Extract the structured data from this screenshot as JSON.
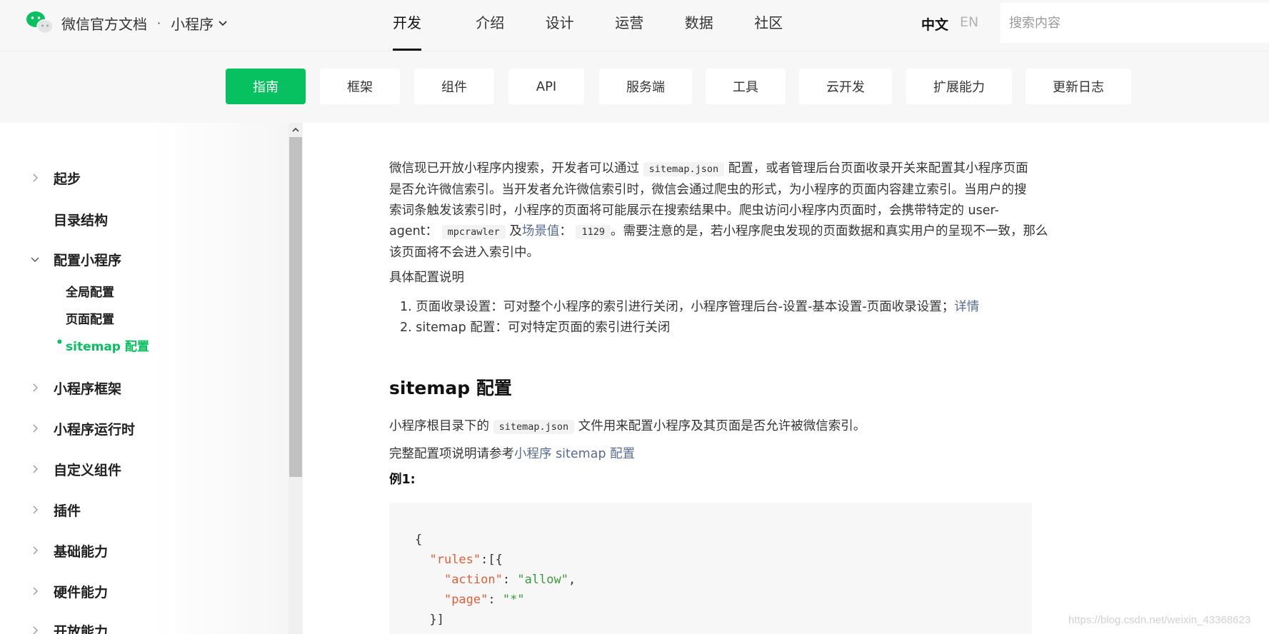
{
  "header": {
    "brand": "微信官方文档",
    "separator": "·",
    "product": "小程序",
    "tabs": [
      {
        "label": "开发",
        "active": true
      },
      {
        "label": "介绍"
      },
      {
        "label": "设计"
      },
      {
        "label": "运营"
      },
      {
        "label": "数据"
      },
      {
        "label": "社区"
      }
    ],
    "lang_zh": "中文",
    "lang_en": "EN",
    "search_placeholder": "搜索内容"
  },
  "subnav": {
    "items": [
      "指南",
      "框架",
      "组件",
      "API",
      "服务端",
      "工具",
      "云开发",
      "扩展能力",
      "更新日志"
    ],
    "active": "指南",
    "accent": "#07c160"
  },
  "sidebar": {
    "items": [
      {
        "label": "起步",
        "state": "collapsed"
      },
      {
        "label": "目录结构",
        "state": "leaf"
      },
      {
        "label": "配置小程序",
        "state": "expanded"
      },
      {
        "label": "小程序框架",
        "state": "collapsed"
      },
      {
        "label": "小程序运行时",
        "state": "collapsed"
      },
      {
        "label": "自定义组件",
        "state": "collapsed"
      },
      {
        "label": "插件",
        "state": "collapsed"
      },
      {
        "label": "基础能力",
        "state": "collapsed"
      },
      {
        "label": "硬件能力",
        "state": "collapsed"
      },
      {
        "label": "开放能力",
        "state": "collapsed"
      }
    ],
    "sub_items": [
      "全局配置",
      "页面配置",
      "sitemap 配置"
    ],
    "active_sub": "sitemap 配置",
    "bullet": "•"
  },
  "content": {
    "intro": {
      "t1": "微信现已开放小程序内搜索，开发者可以通过",
      "code1": "sitemap.json",
      "t2": "配置，或者管理后台页面收录开关来配置其小程序页面",
      "line2": "是否允许微信索引。当开发者允许微信索引时，微信会通过爬虫的形式，为小程序的页面内容建立索引。当用户的搜",
      "line3": "索词条触发该索引时，小程序的页面将可能展示在搜索结果中。爬虫访问小程序内页面时，会携带特定的 user-",
      "t4a": "agent：",
      "code2": "mpcrawler",
      "t4b": "及",
      "link1": "场景值",
      "t4c": "：",
      "code3": "1129",
      "t4d": "。需要注意的是，若小程序爬虫发现的页面数据和真实用户的呈现不一致，那么",
      "line5": "该页面将不会进入索引中。"
    },
    "config_title": "具体配置说明",
    "list": [
      {
        "num": "1.",
        "text": "页面收录设置：可对整个小程序的索引进行关闭，小程序管理后台-设置-基本设置-页面收录设置；",
        "link": "详情"
      },
      {
        "num": "2.",
        "text": "sitemap 配置：可对特定页面的索引进行关闭",
        "link": ""
      }
    ],
    "heading": "sitemap 配置",
    "p1a": "小程序根目录下的",
    "p1code": "sitemap.json",
    "p1b": "文件用来配置小程序及其页面是否允许被微信索引。",
    "p2a": "完整配置项说明请参考",
    "p2link": "小程序 sitemap 配置",
    "example": "例1:",
    "code": {
      "l1": "{",
      "l2k": "\"rules\"",
      "l2r": ":[{",
      "l3k": "\"action\"",
      "l3m": ": ",
      "l3v": "\"allow\"",
      "l3e": ",",
      "l4k": "\"page\"",
      "l4m": ": ",
      "l4v": "\"*\"",
      "l5": "}]"
    }
  },
  "watermark": "https://blog.csdn.net/weixin_43368623"
}
